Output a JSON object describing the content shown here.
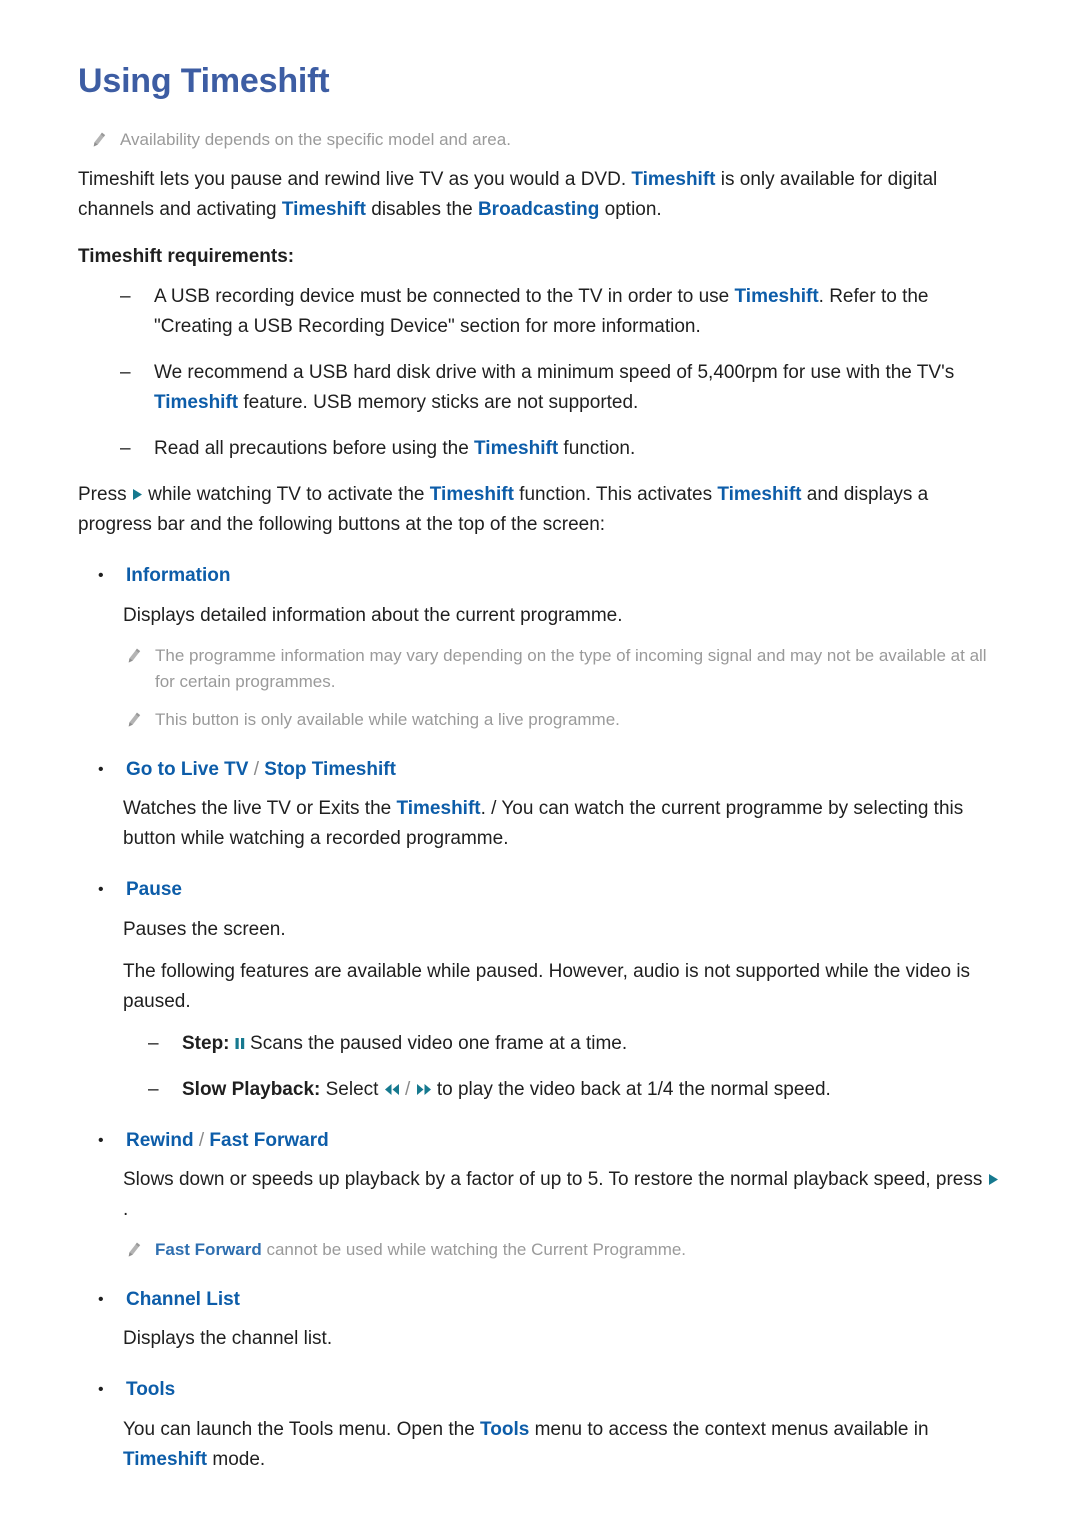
{
  "document": {
    "title": "Using Timeshift",
    "colors": {
      "title_blue": "#3d5da3",
      "term_blue": "#0d5da9",
      "note_grey": "#9a9a9a",
      "glyph_teal": "#16798f",
      "body_black": "#1f1f1f"
    }
  },
  "top_note": {
    "icon": "pencil-icon",
    "text": "Availability depends on the specific model and area."
  },
  "intro": {
    "p1_a": "Timeshift lets you pause and rewind live TV as you would a DVD. ",
    "p1_term1": "Timeshift",
    "p1_b": " is only available for digital channels and activating ",
    "p1_term2": "Timeshift",
    "p1_c": " disables the ",
    "p1_term3": "Broadcasting",
    "p1_d": " option."
  },
  "requirements": {
    "heading": "Timeshift requirements:",
    "items": [
      {
        "marker": "–",
        "a": "A USB recording device must be connected to the TV in order to use ",
        "term": "Timeshift",
        "b": ". Refer to the \"Creating a USB Recording Device\" section for more information."
      },
      {
        "marker": "–",
        "a": "We recommend a USB hard disk drive with a minimum speed of 5,400rpm for use with the TV's ",
        "term": "Timeshift",
        "b": " feature. USB memory sticks are not supported."
      },
      {
        "marker": "–",
        "a": "Read all precautions before using the ",
        "term": "Timeshift",
        "b": " function."
      }
    ]
  },
  "activate": {
    "a": "Press ",
    "glyph": "play-icon",
    "b": " while watching TV to activate the ",
    "term1": "Timeshift",
    "c": " function. This activates ",
    "term2": "Timeshift",
    "d": " and displays a progress bar and the following buttons at the top of the screen:"
  },
  "sections": [
    {
      "id": "information",
      "bullet": "•",
      "label": "Information",
      "body": "Displays detailed information about the current programme.",
      "notes": [
        "The programme information may vary depending on the type of incoming signal and may not be available at all for certain programmes.",
        "This button is only available while watching a live programme."
      ]
    },
    {
      "id": "go-to-live-tv",
      "bullet": "•",
      "label_a": "Go to Live TV",
      "label_sep": " / ",
      "label_b": "Stop Timeshift",
      "body_a": "Watches the live TV or Exits the ",
      "body_term": "Timeshift",
      "body_b": ". / You can watch the current programme by selecting this button while watching a recorded programme."
    },
    {
      "id": "pause",
      "bullet": "•",
      "label": "Pause",
      "body1": "Pauses the screen.",
      "body2": "The following features are available while paused. However, audio is not supported while the video is paused.",
      "sub_items": [
        {
          "marker": "–",
          "bold": "Step:",
          "glyph": "pause-icon",
          "text": " Scans the paused video one frame at a time."
        },
        {
          "marker": "–",
          "bold": "Slow Playback:",
          "text_a": " Select ",
          "glyph_a": "rewind-icon",
          "slash": " / ",
          "glyph_b": "fast-forward-icon",
          "text_b": " to play the video back at 1/4 the normal speed."
        }
      ]
    },
    {
      "id": "rewind-fast-forward",
      "bullet": "•",
      "label_a": "Rewind",
      "label_sep": " / ",
      "label_b": "Fast Forward",
      "body_a": "Slows down or speeds up playback by a factor of up to 5. To restore the normal playback speed, press ",
      "body_glyph": "play-icon",
      "body_b": ".",
      "note_term": "Fast Forward",
      "note_rest": " cannot be used while watching the Current Programme."
    },
    {
      "id": "channel-list",
      "bullet": "•",
      "label": "Channel List",
      "body": "Displays the channel list."
    },
    {
      "id": "tools",
      "bullet": "•",
      "label": "Tools",
      "body_a": "You can launch the Tools menu. Open the ",
      "body_term1": "Tools",
      "body_b": " menu to access the context menus available in ",
      "body_term2": "Timeshift",
      "body_c": " mode."
    }
  ]
}
